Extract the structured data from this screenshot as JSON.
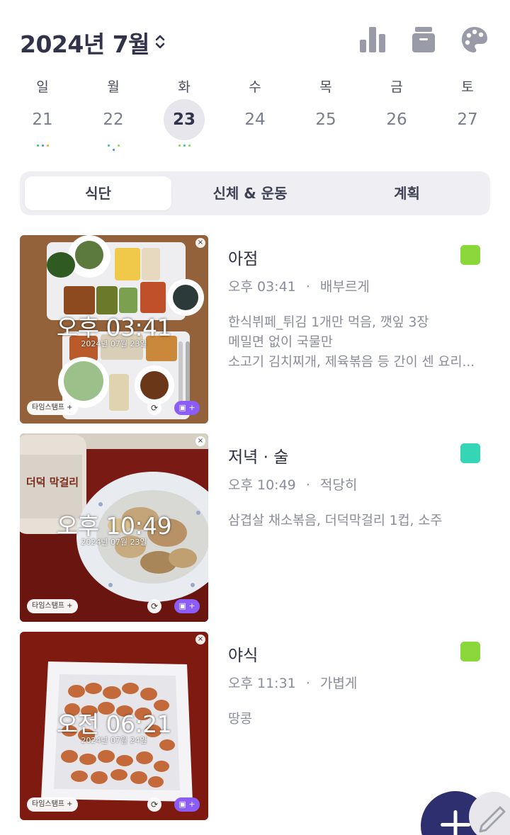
{
  "header": {
    "title": "2024년 7월",
    "icons": [
      "bar-chart-icon",
      "archive-box-icon",
      "palette-icon"
    ]
  },
  "week": [
    {
      "dow": "일",
      "date": "21",
      "selected": false,
      "dots": [
        "#35c98b",
        "#3e8ef7",
        "#f5a623"
      ]
    },
    {
      "dow": "월",
      "date": "22",
      "selected": false,
      "dots": [
        "#35c98b",
        "#3e8ef7",
        "#8bd73c"
      ]
    },
    {
      "dow": "화",
      "date": "23",
      "selected": true,
      "dots": [
        "#8bd73c",
        "#35c98b",
        "#8bd73c"
      ]
    },
    {
      "dow": "수",
      "date": "24",
      "selected": false,
      "dots": []
    },
    {
      "dow": "목",
      "date": "25",
      "selected": false,
      "dots": []
    },
    {
      "dow": "금",
      "date": "26",
      "selected": false,
      "dots": []
    },
    {
      "dow": "토",
      "date": "27",
      "selected": false,
      "dots": []
    }
  ],
  "tabs": [
    {
      "label": "식단",
      "active": true
    },
    {
      "label": "신체 & 운동",
      "active": false
    },
    {
      "label": "계획",
      "active": false
    }
  ],
  "entries": [
    {
      "title": "아점",
      "time": "오후 03:41",
      "fullness": "배부르게",
      "color": "#8bd73c",
      "note_lines": [
        "한식뷔페_튀김 1개만 먹음, 깻잎 3장",
        "메밀면 없이 국물만",
        "소고기 김치찌개, 제육볶음 등 간이 센 요리..."
      ],
      "photo": {
        "time": "오후 03:41",
        "date": "2024년 07월 23일",
        "stamp": "타임스탬프 +",
        "add": "▣ +",
        "sync": "⟳",
        "close": "×"
      }
    },
    {
      "title": "저녁 · 술",
      "time": "오후 10:49",
      "fullness": "적당히",
      "color": "#35d6b6",
      "note_lines": [
        "삼겹살 채소볶음, 더덕막걸리 1컵, 소주"
      ],
      "photo": {
        "time": "오후 10:49",
        "date": "2024년 07월 23일",
        "stamp": "타임스탬프 +",
        "add": "▣ +",
        "sync": "⟳",
        "close": "×",
        "bottle_text": "더덕 막걸리"
      }
    },
    {
      "title": "야식",
      "time": "오후 11:31",
      "fullness": "가볍게",
      "color": "#8bd73c",
      "note_lines": [
        "땅콩"
      ],
      "photo": {
        "time": "오전 06:21",
        "date": "2024년 07월 24일",
        "stamp": "타임스탬프 +",
        "add": "▣ +",
        "sync": "⟳",
        "close": "×"
      }
    }
  ],
  "meta_separator": "·",
  "fab": {
    "icon": "plus-icon",
    "secondary_icon": "pencil-icon"
  }
}
